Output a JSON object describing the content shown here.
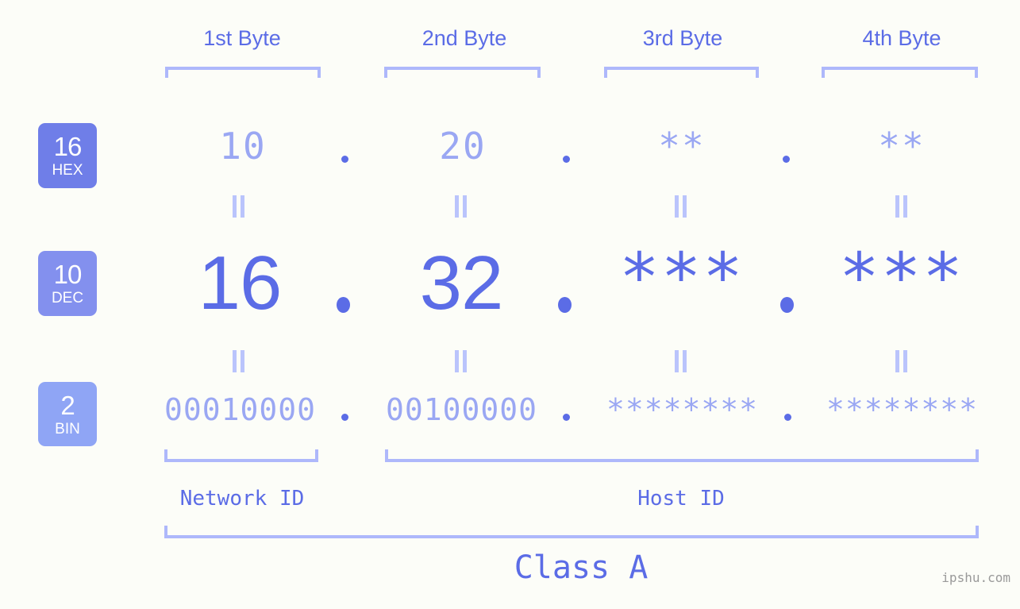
{
  "meta": {
    "background_color": "#fcfdf8",
    "accent_color": "#5b6ce6",
    "light_accent_color": "#9aa7f3",
    "bracket_color": "#aeb8fb",
    "watermark": "ipshu.com"
  },
  "header": {
    "byte_labels": [
      {
        "text": "1st Byte"
      },
      {
        "text": "2nd Byte"
      },
      {
        "text": "3rd Byte"
      },
      {
        "text": "4th Byte"
      }
    ]
  },
  "radix_badges": [
    {
      "number": "16",
      "name": "HEX",
      "color": "#6f7ee8"
    },
    {
      "number": "10",
      "name": "DEC",
      "color": "#8390ee"
    },
    {
      "number": "2",
      "name": "BIN",
      "color": "#8fa5f5"
    }
  ],
  "rows": {
    "hex": {
      "radix": "16",
      "values": [
        "10",
        "20",
        "**",
        "**"
      ],
      "separator": "."
    },
    "dec": {
      "radix": "10",
      "values": [
        "16",
        "32",
        "***",
        "***"
      ],
      "separator": "."
    },
    "bin": {
      "radix": "2",
      "values": [
        "00010000",
        "00100000",
        "********",
        "********"
      ],
      "separator": "."
    }
  },
  "equals_symbol": "=",
  "footer": {
    "network_id_label": "Network ID",
    "host_id_label": "Host ID",
    "class_label": "Class A"
  }
}
